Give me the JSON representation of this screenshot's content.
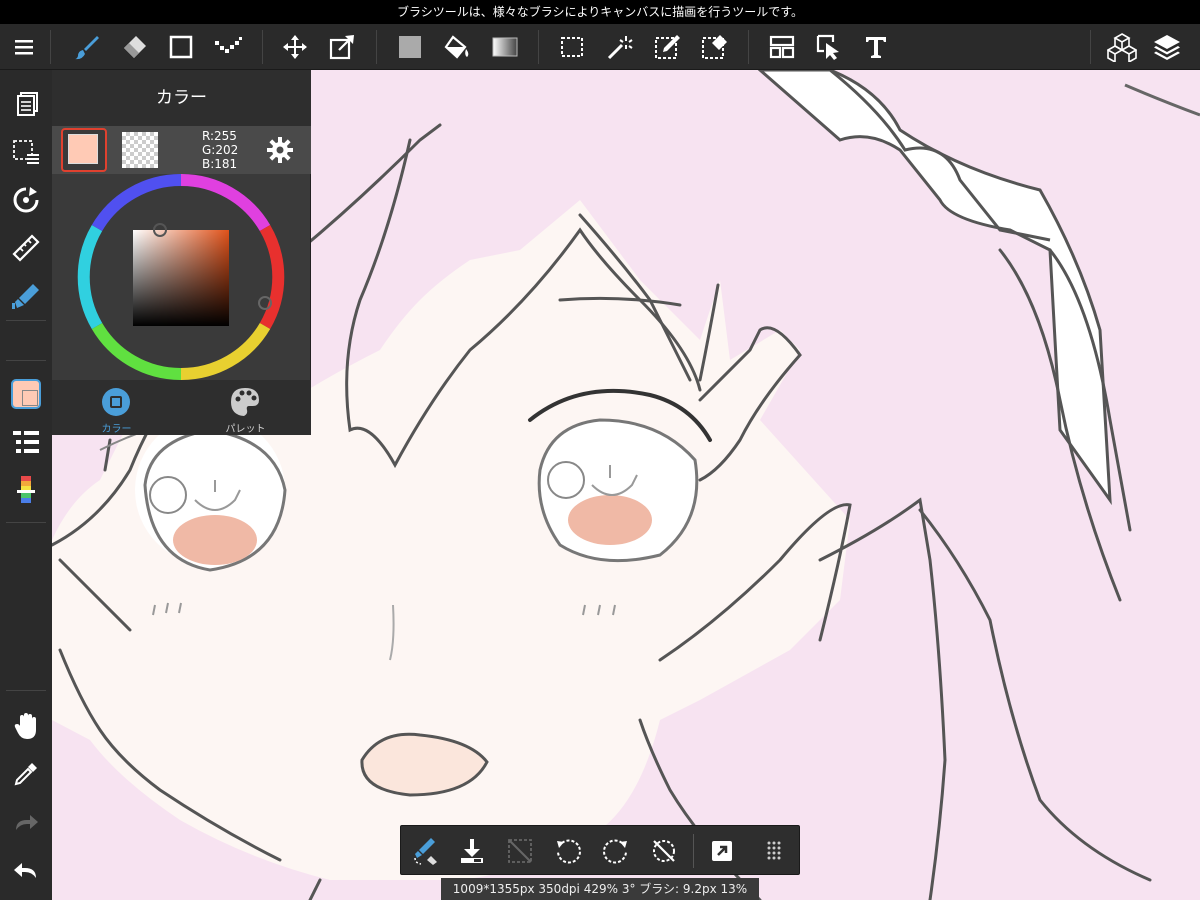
{
  "status_bar": {
    "hint": "ブラシツールは、様々なブラシによりキャンバスに描画を行うツールです。"
  },
  "toolbar": {
    "tools": [
      {
        "name": "menu",
        "icon": "menu-icon"
      },
      {
        "name": "brush",
        "icon": "brush-icon",
        "active": true
      },
      {
        "name": "eraser",
        "icon": "eraser-icon"
      },
      {
        "name": "shape",
        "icon": "rectangle-icon"
      },
      {
        "name": "dot",
        "icon": "dot-pen-icon"
      },
      {
        "name": "move",
        "icon": "move-icon"
      },
      {
        "name": "transform",
        "icon": "transform-icon"
      },
      {
        "name": "fill-color",
        "icon": "fill-rect-icon"
      },
      {
        "name": "bucket",
        "icon": "bucket-icon"
      },
      {
        "name": "gradient",
        "icon": "gradient-icon"
      },
      {
        "name": "select",
        "icon": "select-rect-icon"
      },
      {
        "name": "magic-wand",
        "icon": "magic-wand-icon"
      },
      {
        "name": "select-pen",
        "icon": "select-pen-icon"
      },
      {
        "name": "select-eraser",
        "icon": "select-eraser-icon"
      },
      {
        "name": "frame",
        "icon": "frame-divide-icon"
      },
      {
        "name": "operation",
        "icon": "operation-cursor-icon"
      },
      {
        "name": "text",
        "icon": "text-icon"
      },
      {
        "name": "3d",
        "icon": "cubes-icon"
      },
      {
        "name": "layers",
        "icon": "layers-icon"
      }
    ]
  },
  "color_panel": {
    "title": "カラー",
    "r_label": "R:255",
    "g_label": "G:202",
    "b_label": "B:181",
    "current_color": "#ffcab5",
    "tabs": [
      {
        "label": "カラー",
        "active": true
      },
      {
        "label": "パレット",
        "active": false
      }
    ]
  },
  "bottom_bar": {
    "info": "1009*1355px 350dpi 429% 3° ブラシ: 9.2px 13%"
  },
  "colors": {
    "accent_blue": "#4a9ed9",
    "selected_red": "#e0412f",
    "hair_pink": "#f7e3f1",
    "skin": "#fdf6f3"
  }
}
